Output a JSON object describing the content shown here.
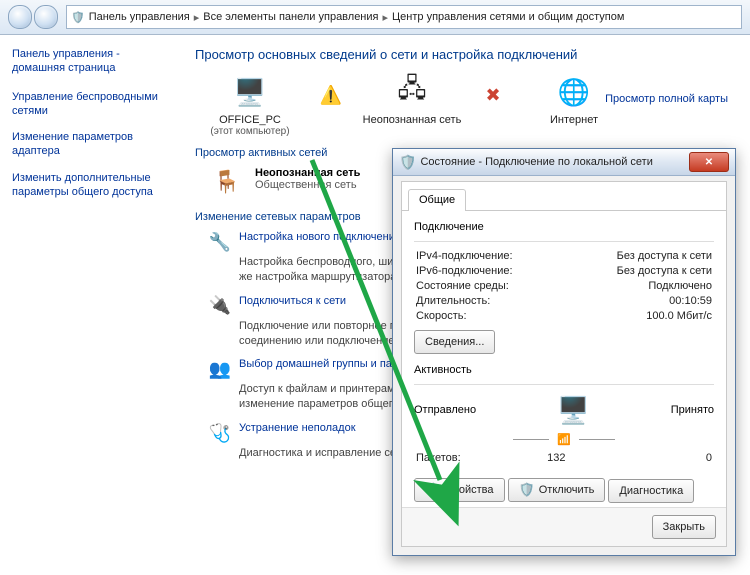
{
  "breadcrumb": [
    "Панель управления",
    "Все элементы панели управления",
    "Центр управления сетями и общим доступом"
  ],
  "sidebar": {
    "home": "Панель управления - домашняя страница",
    "items": [
      "Управление беспроводными сетями",
      "Изменение параметров адаптера",
      "Изменить дополнительные параметры общего доступа"
    ]
  },
  "main": {
    "title": "Просмотр основных сведений о сети и настройка подключений",
    "map_link": "Просмотр полной карты",
    "map": [
      {
        "label": "OFFICE_PC",
        "sub": "(этот компьютер)"
      },
      {
        "label": "Неопознанная сеть"
      },
      {
        "label": "Интернет"
      }
    ],
    "sec_active": "Просмотр активных сетей",
    "active_net": {
      "name": "Неопознанная сеть",
      "type": "Общественная сеть"
    },
    "sec_change": "Изменение сетевых параметров",
    "tasks": [
      {
        "title": "Настройка нового подключения",
        "desc": "Настройка беспроводного, широкополосного, модемного, прямого или VPN-подключения или же настройка маршрутизатора"
      },
      {
        "title": "Подключиться к сети",
        "desc": "Подключение или повторное подключение к беспроводному, проводному, модемному сетевому соединению или подключение к VPN."
      },
      {
        "title": "Выбор домашней группы и параметров",
        "desc": "Доступ к файлам и принтерам, расположенным на других сетевых компьютерах, или изменение параметров общего доступа."
      },
      {
        "title": "Устранение неполадок",
        "desc": "Диагностика и исправление сетевых проблем"
      }
    ]
  },
  "dialog": {
    "title": "Состояние - Подключение по локальной сети",
    "tab": "Общие",
    "grp_conn": "Подключение",
    "conn": [
      {
        "k": "IPv4-подключение:",
        "v": "Без доступа к сети"
      },
      {
        "k": "IPv6-подключение:",
        "v": "Без доступа к сети"
      },
      {
        "k": "Состояние среды:",
        "v": "Подключено"
      },
      {
        "k": "Длительность:",
        "v": "00:10:59"
      },
      {
        "k": "Скорость:",
        "v": "100.0 Мбит/с"
      }
    ],
    "btn_details": "Сведения...",
    "grp_act": "Активность",
    "act": {
      "sent_label": "Отправлено",
      "recv_label": "Принято",
      "packets_label": "Пакетов:",
      "sent": "132",
      "recv": "0"
    },
    "btn_props": "Свойства",
    "btn_disable": "Отключить",
    "btn_diag": "Диагностика",
    "btn_close": "Закрыть"
  }
}
